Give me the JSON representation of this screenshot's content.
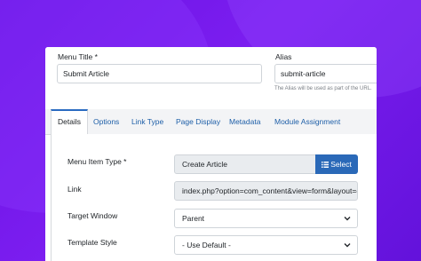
{
  "top": {
    "menu_title_label": "Menu Title *",
    "menu_title_value": "Submit Article",
    "alias_label": "Alias",
    "alias_value": "submit-article",
    "alias_hint": "The Alias will be used as part of the URL."
  },
  "tabs": [
    {
      "label": "Details",
      "active": true
    },
    {
      "label": "Options"
    },
    {
      "label": "Link Type"
    },
    {
      "label": "Page Display"
    },
    {
      "label": "Metadata"
    },
    {
      "label": "Module Assignment"
    }
  ],
  "details": {
    "menu_item_type_label": "Menu Item Type *",
    "menu_item_type_value": "Create Article",
    "select_button_label": "Select",
    "link_label": "Link",
    "link_value": "index.php?option=com_content&view=form&layout=ec",
    "target_window_label": "Target Window",
    "target_window_value": "Parent",
    "template_style_label": "Template Style",
    "template_style_value": "- Use Default -"
  },
  "icons": {
    "select": "list-icon",
    "dropdown": "chevron-down-icon"
  },
  "colors": {
    "background": "#6f14e6",
    "accent": "#2a69b8",
    "link": "#1e5fa8"
  }
}
